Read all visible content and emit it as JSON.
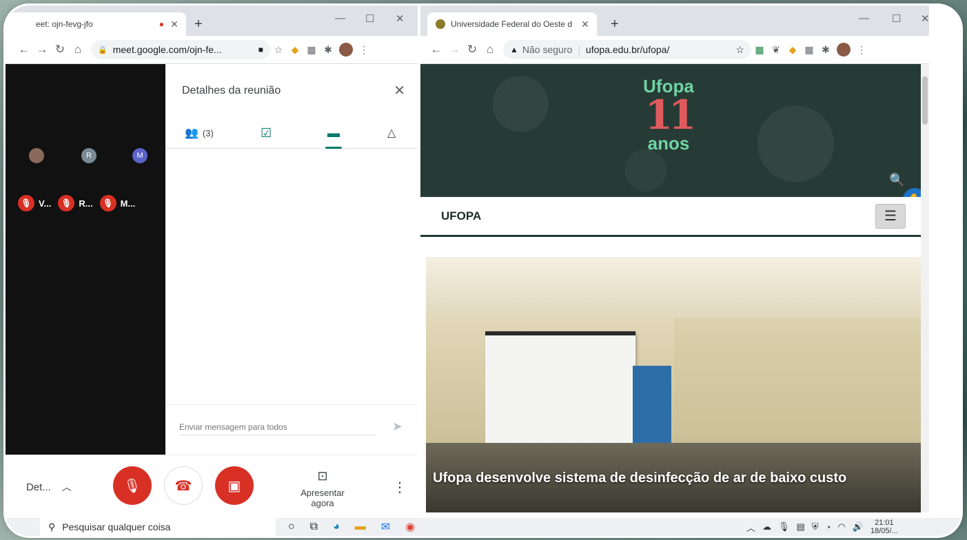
{
  "meet": {
    "tab_title": "eet: ojn-fevg-jfo",
    "url": "meet.google.com/ojn-fe...",
    "details_title": "Detalhes da reunião",
    "people_count": "(3)",
    "participants": [
      {
        "initial": "",
        "name": "V...",
        "avatar_color": "#8a6a5a"
      },
      {
        "initial": "R",
        "name": "R...",
        "avatar_color": "#7a8a94"
      },
      {
        "initial": "M",
        "name": "M...",
        "avatar_color": "#5b64c9"
      }
    ],
    "chat_placeholder": "Enviar mensagem para todos",
    "details_button": "Det...",
    "present_label": "Apresentar agora"
  },
  "ufopa": {
    "tab_title": "Universidade Federal do Oeste d",
    "security_label": "Não seguro",
    "url": "ufopa.edu.br/ufopa/",
    "logo_word": "Ufopa",
    "logo_number": "11",
    "logo_anos": "anos",
    "nav_brand": "UFOPA",
    "news_caption": "Ufopa desenvolve sistema de desinfecção de ar de baixo custo"
  },
  "taskbar": {
    "search_placeholder": "Pesquisar qualquer coisa",
    "time": "21:01",
    "date": "18/05/..."
  },
  "colors": {
    "meet_red": "#d93025",
    "meet_teal": "#00796b",
    "ufopa_green_dark": "#273b36",
    "ufopa_logo_green": "#6fd3a2",
    "ufopa_logo_red": "#e05a5d"
  }
}
